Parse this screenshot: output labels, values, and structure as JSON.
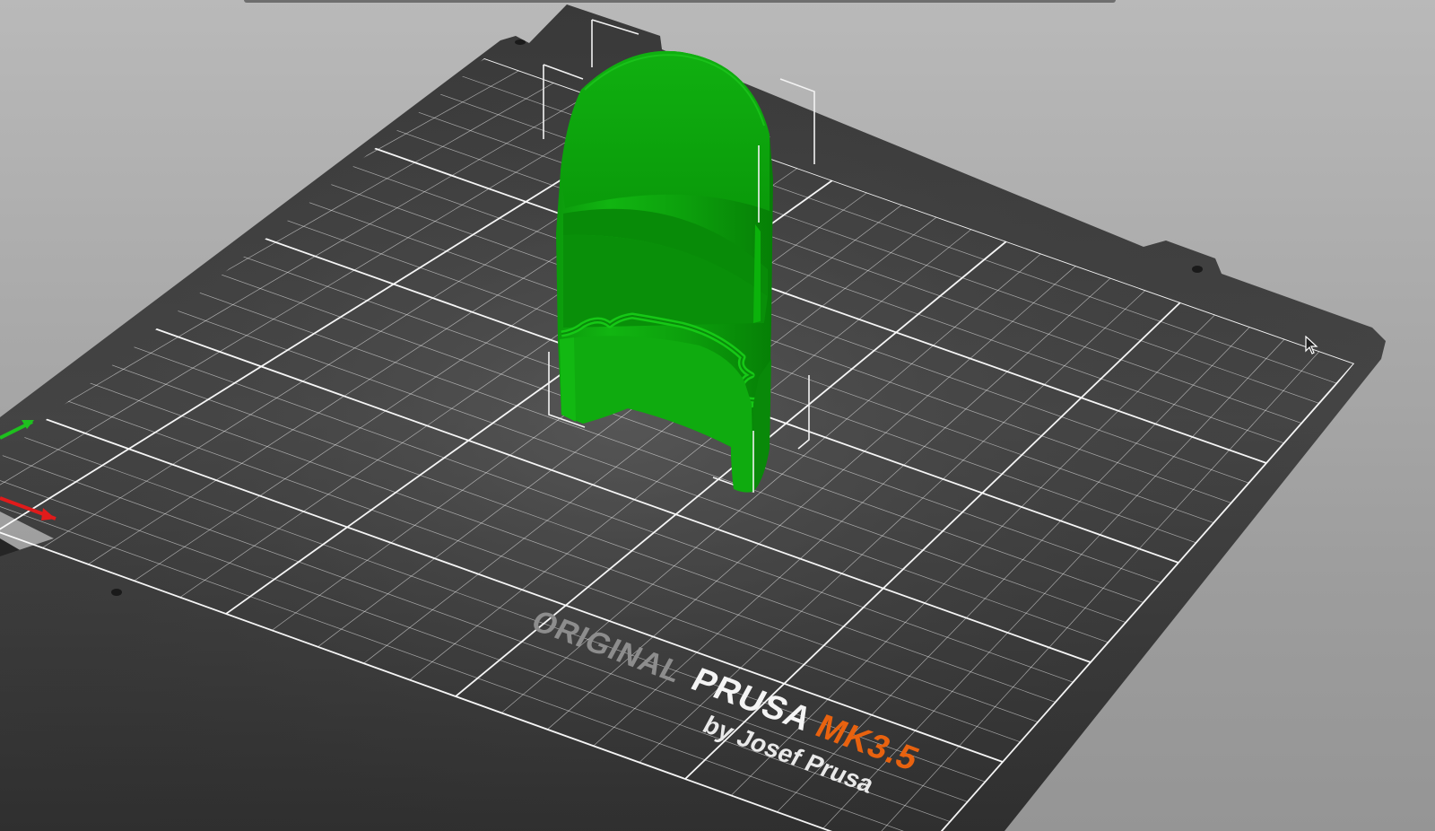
{
  "viewport": {
    "name": "3d-scene-view",
    "background_color": "#a8a8a8"
  },
  "bed": {
    "logo_original": "ORIGINAL",
    "logo_prusa": "PRUSA",
    "logo_model": "MK3.5",
    "logo_byline": "by Josef Prusa",
    "plate_color": "#2e2e2e",
    "grid_color": "#ffffff",
    "model_color_accent": "#e8620f"
  },
  "object": {
    "color_light": "#12c412",
    "color_mid": "#0aa80a",
    "color_dark": "#067a06"
  },
  "axes": {
    "x_color": "#e01b1b",
    "y_color": "#1ec01e"
  },
  "cursor": {
    "icon": "mouse-pointer-icon"
  }
}
